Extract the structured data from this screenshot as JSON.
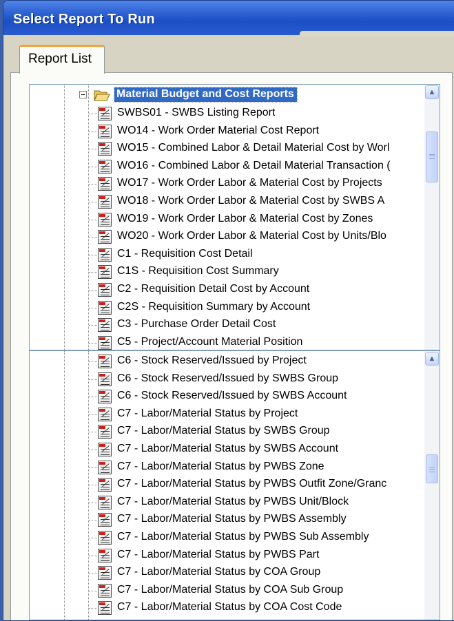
{
  "window": {
    "title": "Select Report To Run"
  },
  "tabs": [
    {
      "label": "Report List",
      "active": true
    }
  ],
  "tree_top": {
    "folder": {
      "label": "Material Budget and Cost Reports",
      "expanded": true,
      "selected": true
    },
    "items": [
      "SWBS01 - SWBS Listing Report",
      "WO14 - Work Order Material Cost Report",
      "WO15 - Combined Labor & Detail Material Cost by Worl",
      "WO16 - Combined Labor & Detail Material Transaction (",
      "WO17 - Work Order Labor & Material Cost by Projects",
      "WO18  - Work Order Labor & Material Cost by SWBS A",
      "WO19 - Work Order Labor & Material Cost by Zones",
      "WO20 - Work Order Labor & Material Cost by Units/Blo",
      "C1 - Requisition Cost Detail",
      "C1S - Requisition Cost Summary",
      "C2 - Requisition Detail Cost by Account",
      "C2S - Requisition Summary by Account",
      "C3 - Purchase Order Detail Cost",
      "C5 - Project/Account Material Position"
    ]
  },
  "tree_bottom": {
    "items": [
      "C6 - Stock Reserved/Issued by Project",
      "C6 - Stock Reserved/Issued by SWBS Group",
      "C6 - Stock Reserved/Issued by SWBS Account",
      "C7 - Labor/Material Status by Project",
      "C7 - Labor/Material Status by SWBS Group",
      "C7 - Labor/Material Status by SWBS Account",
      "C7 - Labor/Material Status by PWBS Zone",
      "C7 - Labor/Material Status by PWBS Outfit Zone/Granc",
      "C7 - Labor/Material Status by PWBS Unit/Block",
      "C7 - Labor/Material Status by PWBS Assembly",
      "C7 - Labor/Material Status by PWBS Sub Assembly",
      "C7 - Labor/Material Status by PWBS Part",
      "C7 - Labor/Material Status by COA Group",
      "C7 - Labor/Material Status by COA Sub Group",
      "C7 - Labor/Material Status by COA Cost Code"
    ]
  },
  "icons": {
    "report": "report-document-icon",
    "folder": "open-folder-icon",
    "collapse": "tree-collapse-icon",
    "scroll_up": "scroll-up-arrow-icon"
  },
  "colors": {
    "title_bar": "#2f62d4",
    "selection": "#316ac5",
    "tab_accent": "#f4a23a"
  }
}
